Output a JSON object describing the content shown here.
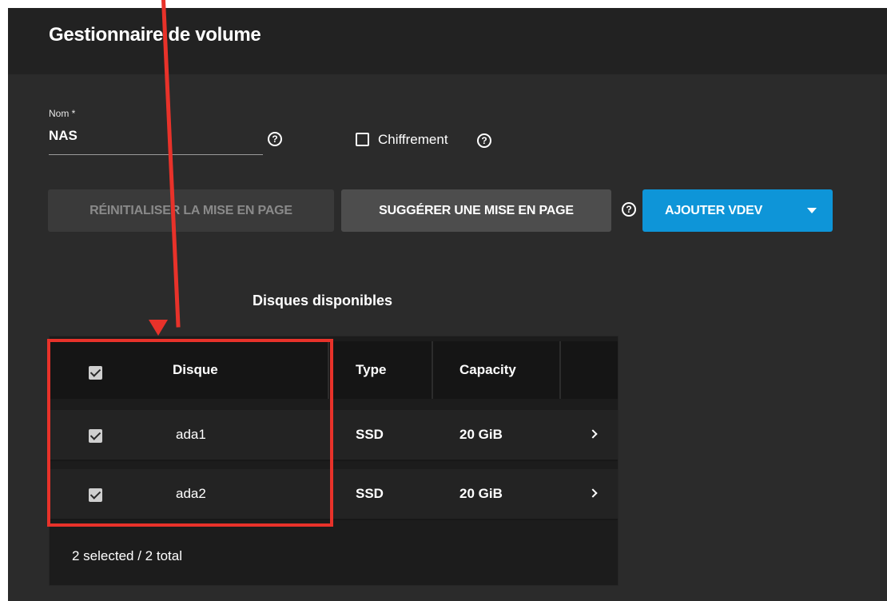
{
  "page": {
    "title": "Gestionnaire de volume"
  },
  "form": {
    "name_label": "Nom *",
    "name_value": "NAS",
    "encryption_label": "Chiffrement",
    "encryption_checked": false
  },
  "buttons": {
    "reset_layout": "RÉINITIALISER LA MISE EN PAGE",
    "suggest_layout": "SUGGÉRER UNE MISE EN PAGE",
    "add_vdev": "AJOUTER VDEV"
  },
  "disks": {
    "title": "Disques disponibles",
    "headers": {
      "disk": "Disque",
      "type": "Type",
      "capacity": "Capacity"
    },
    "rows": [
      {
        "disk": "ada1",
        "type": "SSD",
        "capacity": "20 GiB",
        "selected": true
      },
      {
        "disk": "ada2",
        "type": "SSD",
        "capacity": "20 GiB",
        "selected": true
      }
    ],
    "footer": "2 selected / 2 total"
  },
  "colors": {
    "accent": "#0e95d8",
    "annotation": "#e8322a",
    "background": "#2b2b2b"
  },
  "icons": {
    "help": "help-circle-icon",
    "row_expand": "chevron-right-icon",
    "dropdown": "caret-down-icon"
  }
}
